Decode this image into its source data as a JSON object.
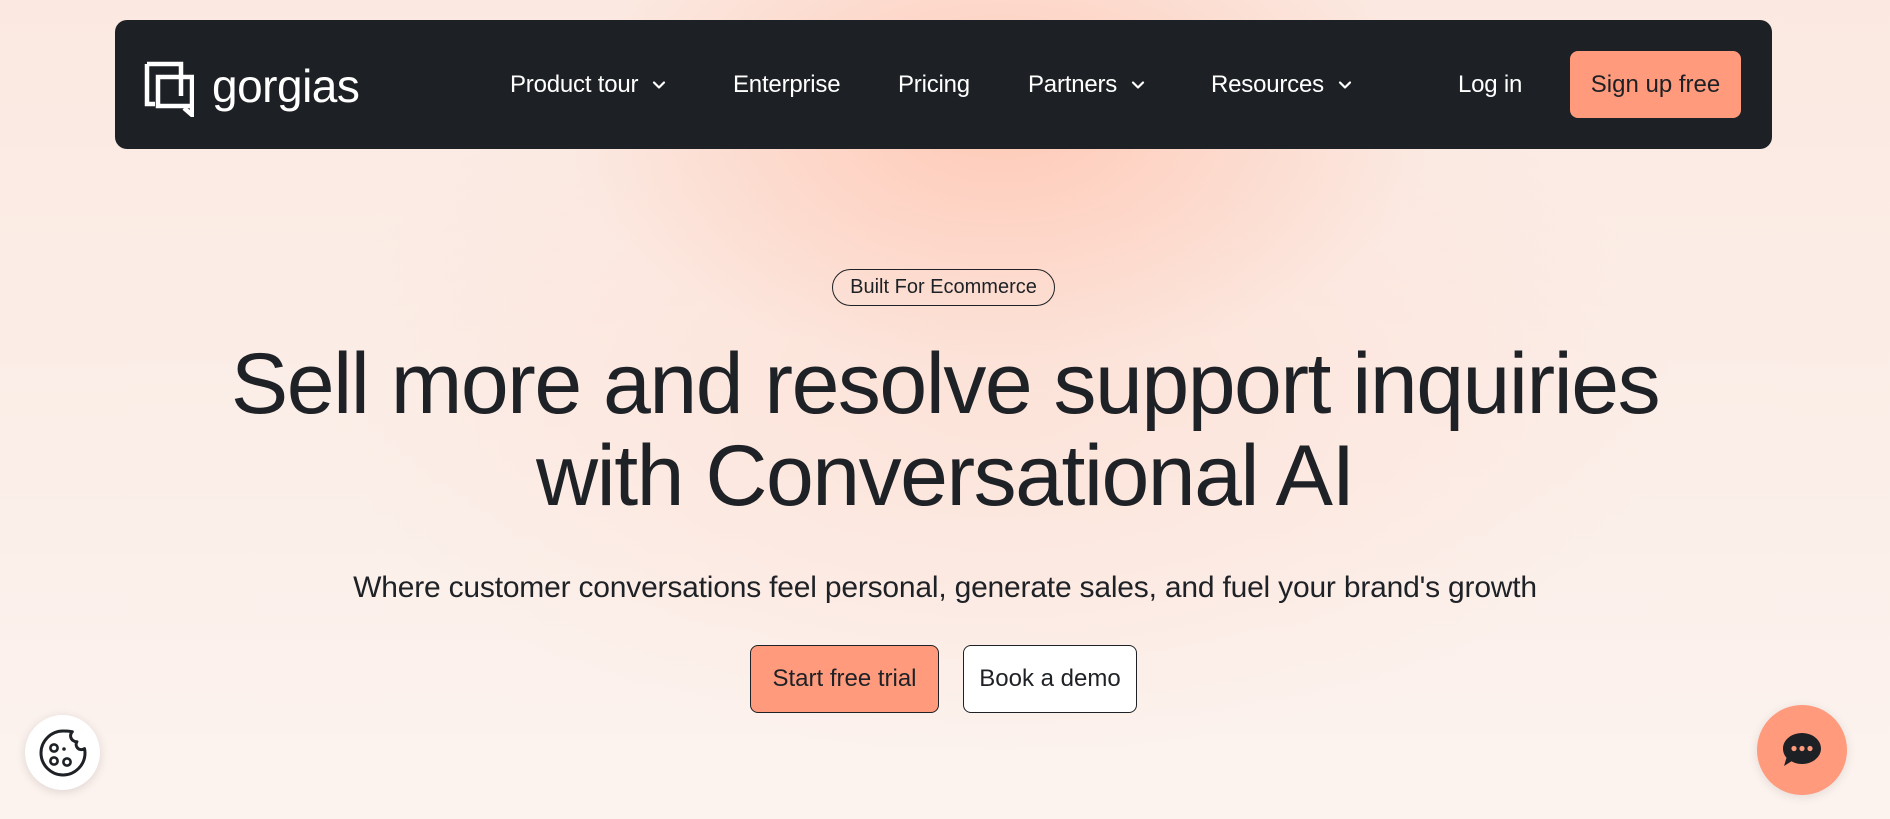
{
  "colors": {
    "nav_background": "#1d2024",
    "accent": "#ff9a7c",
    "text": "#1e2125",
    "white": "#ffffff"
  },
  "brand": {
    "logo_text": "gorgias",
    "logo_icon": "gorgias-logo-icon"
  },
  "nav": {
    "items": [
      {
        "label": "Product tour",
        "has_dropdown": true
      },
      {
        "label": "Enterprise",
        "has_dropdown": false
      },
      {
        "label": "Pricing",
        "has_dropdown": false
      },
      {
        "label": "Partners",
        "has_dropdown": true
      },
      {
        "label": "Resources",
        "has_dropdown": true
      }
    ],
    "login_label": "Log in",
    "signup_label": "Sign up free"
  },
  "hero": {
    "badge": "Built For Ecommerce",
    "headline_line1": "Sell more and resolve support inquiries",
    "headline_line2": "with Conversational AI",
    "subheadline": "Where customer conversations feel personal, generate sales, and fuel your brand's growth",
    "cta_primary": "Start free trial",
    "cta_secondary": "Book a demo"
  },
  "widgets": {
    "cookie_icon": "cookie-icon",
    "chat_icon": "chat-bubble-icon"
  }
}
